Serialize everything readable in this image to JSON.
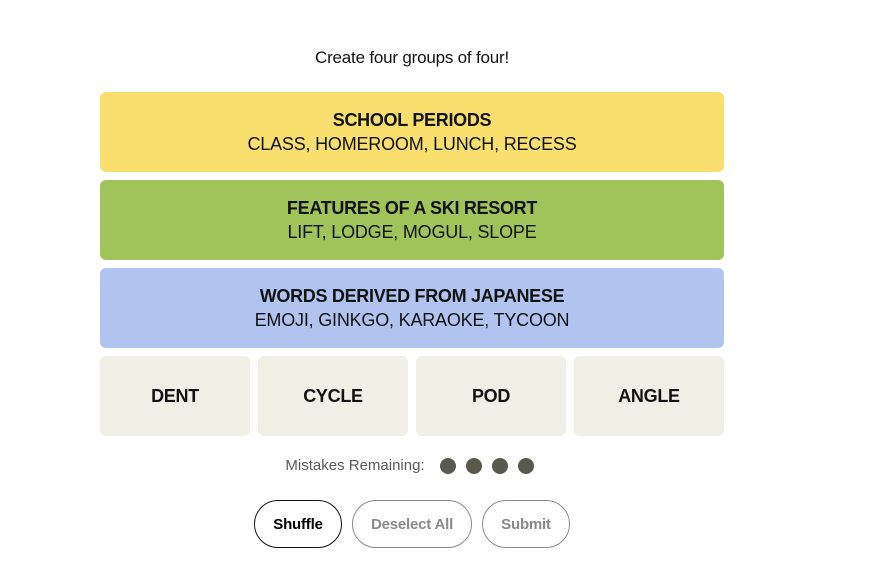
{
  "subtitle": "Create four groups of four!",
  "solved_groups": [
    {
      "title": "SCHOOL PERIODS",
      "members": "CLASS, HOMEROOM, LUNCH, RECESS",
      "color": "#f9df6d"
    },
    {
      "title": "FEATURES OF A SKI RESORT",
      "members": "LIFT, LODGE, MOGUL, SLOPE",
      "color": "#a0c35a"
    },
    {
      "title": "WORDS DERIVED FROM JAPANESE",
      "members": "EMOJI, GINKGO, KARAOKE, TYCOON",
      "color": "#b0c4ef"
    }
  ],
  "tiles": [
    "DENT",
    "CYCLE",
    "POD",
    "ANGLE"
  ],
  "mistakes": {
    "label": "Mistakes Remaining:",
    "remaining": 4
  },
  "buttons": {
    "shuffle": "Shuffle",
    "deselect_all": "Deselect All",
    "submit": "Submit"
  }
}
